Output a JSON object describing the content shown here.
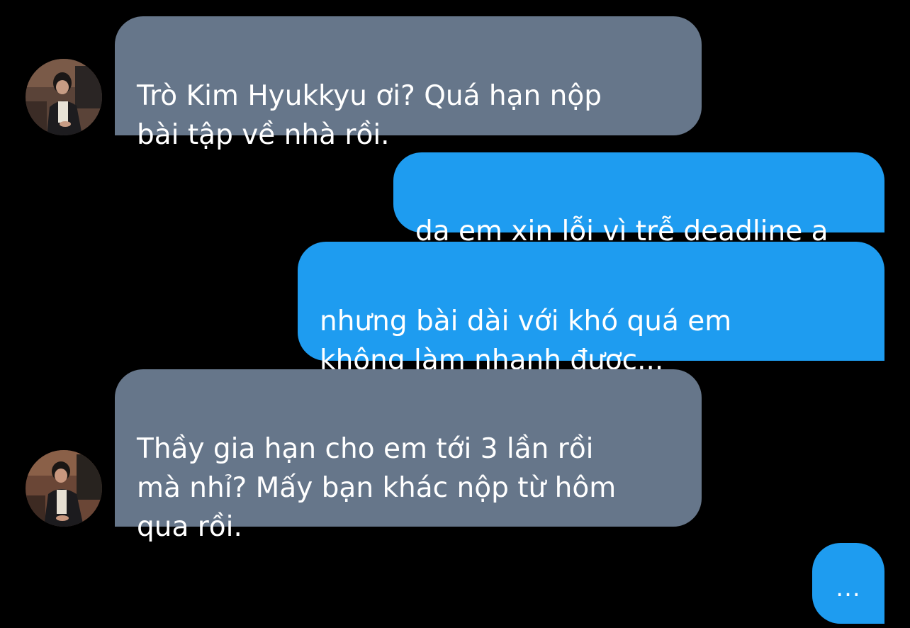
{
  "colors": {
    "background": "#000000",
    "incoming_bubble": "#66768a",
    "outgoing_bubble": "#1e9cf0",
    "text": "#ffffff"
  },
  "conversation": {
    "messages": [
      {
        "side": "incoming",
        "text": "Trò Kim Hyukkyu ơi? Quá hạn nộp\nbài tập về nhà rồi.",
        "has_avatar": true
      },
      {
        "side": "outgoing",
        "text": "dạ em xin lỗi vì trễ deadline ạ"
      },
      {
        "side": "outgoing",
        "text": "nhưng bài dài với khó quá em\nkhông làm nhanh được..."
      },
      {
        "side": "incoming",
        "text": "Thầy gia hạn cho em tới 3 lần rồi\nmà nhỉ? Mấy bạn khác nộp từ hôm\nqua rồi.",
        "has_avatar": true
      }
    ],
    "typing_indicator": "...",
    "avatar_icon": "contact-photo"
  }
}
